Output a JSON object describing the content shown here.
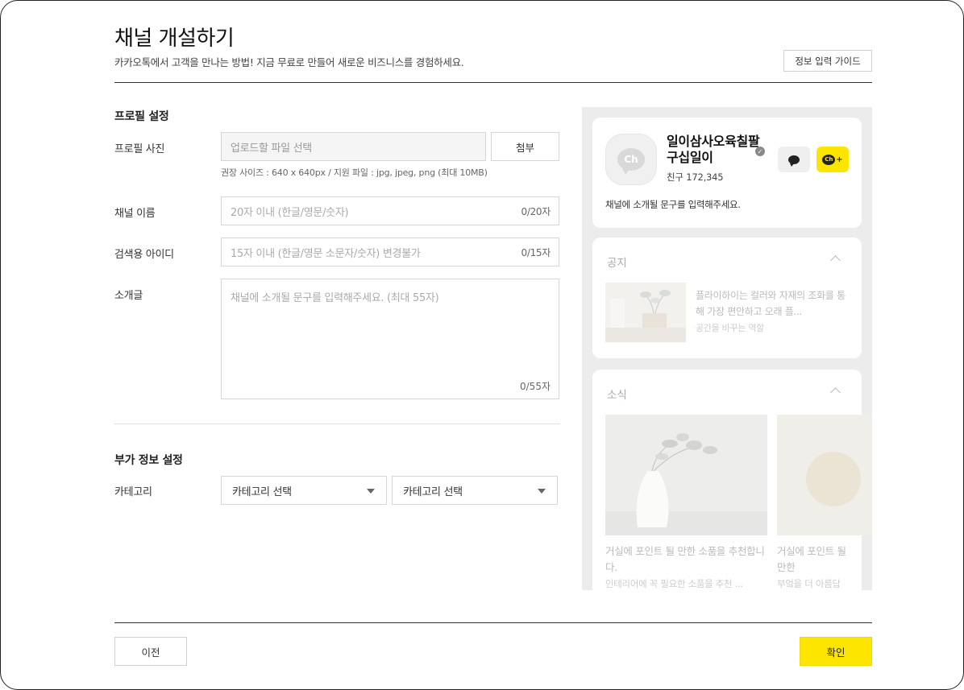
{
  "header": {
    "title": "채널 개설하기",
    "subtitle": "카카오톡에서 고객을 만나는 방법! 지금 무료로 만들어 새로운 비즈니스를 경험하세요.",
    "guide_button": "정보 입력 가이드"
  },
  "profile_section": {
    "title": "프로필 설정",
    "photo": {
      "label": "프로필 사진",
      "placeholder": "업로드할 파일 선택",
      "attach_button": "첨부",
      "hint": "권장 사이즈 : 640 x 640px / 지원 파일 : jpg, jpeg, png (최대 10MB)"
    },
    "channel_name": {
      "label": "채널 이름",
      "placeholder": "20자 이내 (한글/영문/숫자)",
      "counter": "0/20자"
    },
    "search_id": {
      "label": "검색용 아이디",
      "placeholder": "15자 이내 (한글/영문 소문자/숫자) 변경불가",
      "counter": "0/15자"
    },
    "intro": {
      "label": "소개글",
      "placeholder": "채널에 소개될 문구를 입력해주세요. (최대 55자)",
      "counter": "0/55자"
    }
  },
  "extra_section": {
    "title": "부가 정보 설정",
    "category": {
      "label": "카테고리",
      "select1": "카테고리 선택",
      "select2": "카테고리 선택"
    }
  },
  "preview": {
    "avatar_text": "Ch",
    "channel_name": "일이삼사오육칠팔구십일이",
    "friends": "친구 172,345",
    "intro": "채널에 소개될 문구를 입력해주세요.",
    "add_button_text": "Ch",
    "add_button_plus": "+",
    "notice": {
      "title": "공지",
      "text": "플라이하이는 컬러와 자재의 조화를 통해 가장 편안하고 오래 플...",
      "sub": "공간을 바꾸는 역할"
    },
    "news": {
      "title": "소식",
      "items": [
        {
          "text": "거실에 포인트 될 만한 소품을 추천합니다.",
          "sub": "인테리어에 꼭 필요한 소품을 추천 ..."
        },
        {
          "text": "거실에 포인트 될 만한",
          "sub": "부엌을 더 아름답"
        }
      ]
    }
  },
  "footer": {
    "prev_button": "이전",
    "confirm_button": "확인"
  },
  "colors": {
    "accent_yellow": "#fee500",
    "border": "#d6d6d6",
    "preview_bg": "#ececec"
  },
  "icons": [
    "verified-icon",
    "chat-icon",
    "add-friend-icon",
    "chevron-up-icon",
    "caret-down-icon"
  ]
}
